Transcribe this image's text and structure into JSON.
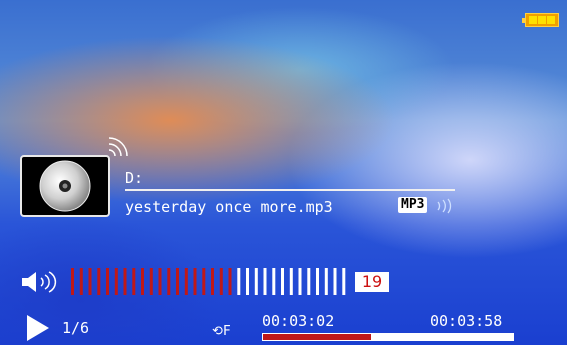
{
  "status": {
    "battery_icon": "battery-full-icon"
  },
  "track": {
    "drive": "D:",
    "filename": "yesterday once more.mp3",
    "format": "MP3",
    "index": "1/6"
  },
  "volume": {
    "value": "19",
    "level": 19,
    "max": 32
  },
  "playback": {
    "repeat_label": "F",
    "current_time": "00:03:02",
    "total_time": "00:03:58",
    "progress": 0.43
  },
  "colors": {
    "volume_active": "#c01818",
    "progress_fill": "#c01818",
    "battery": "#ffd000"
  }
}
